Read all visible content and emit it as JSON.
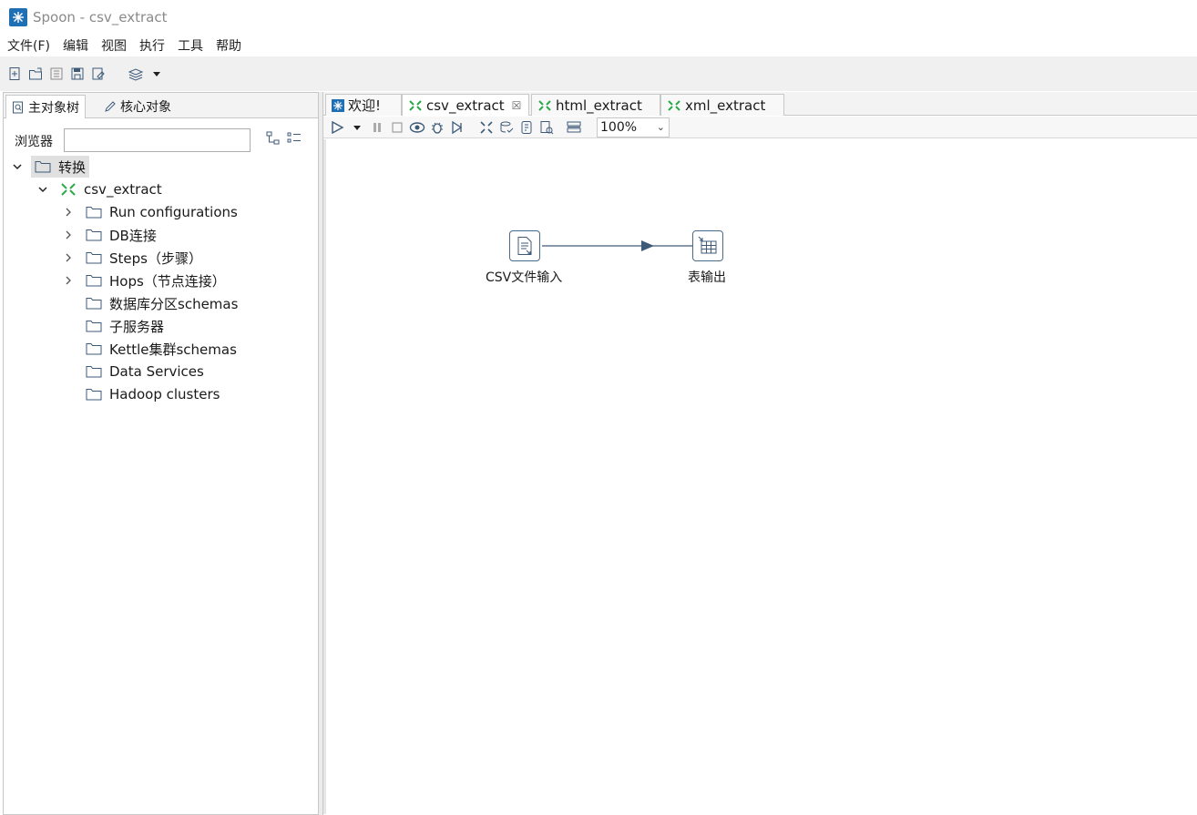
{
  "window": {
    "title": "Spoon - csv_extract"
  },
  "menu": [
    "文件(F)",
    "编辑",
    "视图",
    "执行",
    "工具",
    "帮助"
  ],
  "left_tabs": {
    "main_tree": "主对象树",
    "core_objects": "核心对象"
  },
  "browser": {
    "label": "浏览器",
    "value": ""
  },
  "tree": {
    "root": "转换",
    "transform": "csv_extract",
    "items": [
      "Run configurations",
      "DB连接",
      "Steps（步骤）",
      "Hops（节点连接）",
      "数据库分区schemas",
      "子服务器",
      "Kettle集群schemas",
      "Data Services",
      "Hadoop clusters"
    ]
  },
  "doc_tabs": [
    "欢迎!",
    "csv_extract",
    "html_extract",
    "xml_extract"
  ],
  "zoom": "100%",
  "steps": {
    "input": "CSV文件输入",
    "output": "表输出"
  },
  "colors": {
    "accent": "#1f6fb5",
    "transform_green": "#2aa84a",
    "hop": "#3d5a78"
  }
}
